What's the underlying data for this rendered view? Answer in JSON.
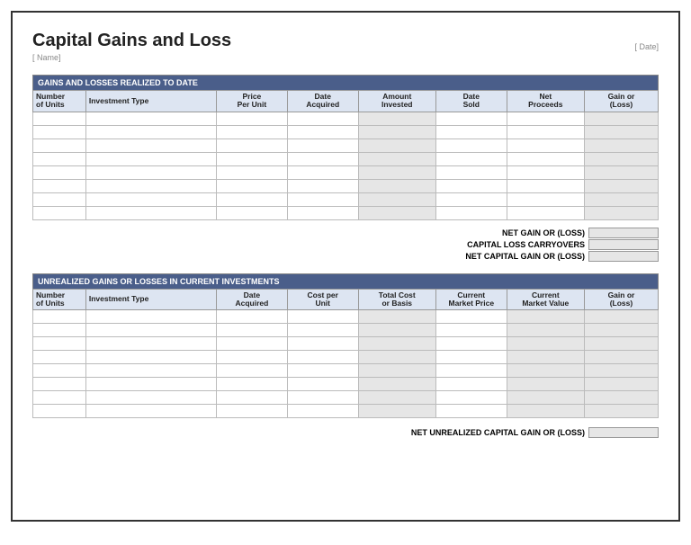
{
  "header": {
    "title": "Capital Gains and Loss",
    "date_placeholder": "[ Date]",
    "name_placeholder": "[ Name]"
  },
  "realized": {
    "section_title": "GAINS AND LOSSES REALIZED TO DATE",
    "columns": {
      "c1": "Number\nof Units",
      "c2": "Investment Type",
      "c3": "Price\nPer Unit",
      "c4": "Date\nAcquired",
      "c5": "Amount\nInvested",
      "c6": "Date\nSold",
      "c7": "Net\nProceeds",
      "c8": "Gain or\n(Loss)"
    },
    "rows": [
      "",
      "",
      "",
      "",
      "",
      "",
      "",
      ""
    ],
    "summary": {
      "net_gain_loss_label": "NET GAIN OR (LOSS)",
      "carryovers_label": "CAPITAL LOSS CARRYOVERS",
      "net_capital_label": "NET CAPITAL GAIN OR (LOSS)"
    }
  },
  "unrealized": {
    "section_title": "UNREALIZED GAINS OR LOSSES IN CURRENT INVESTMENTS",
    "columns": {
      "c1": "Number\nof Units",
      "c2": "Investment Type",
      "c3": "Date\nAcquired",
      "c4": "Cost per\nUnit",
      "c5": "Total Cost\nor Basis",
      "c6": "Current\nMarket Price",
      "c7": "Current\nMarket Value",
      "c8": "Gain or\n(Loss)"
    },
    "rows": [
      "",
      "",
      "",
      "",
      "",
      "",
      "",
      ""
    ],
    "summary": {
      "net_unrealized_label": "NET UNREALIZED CAPITAL GAIN OR  (LOSS)"
    }
  }
}
